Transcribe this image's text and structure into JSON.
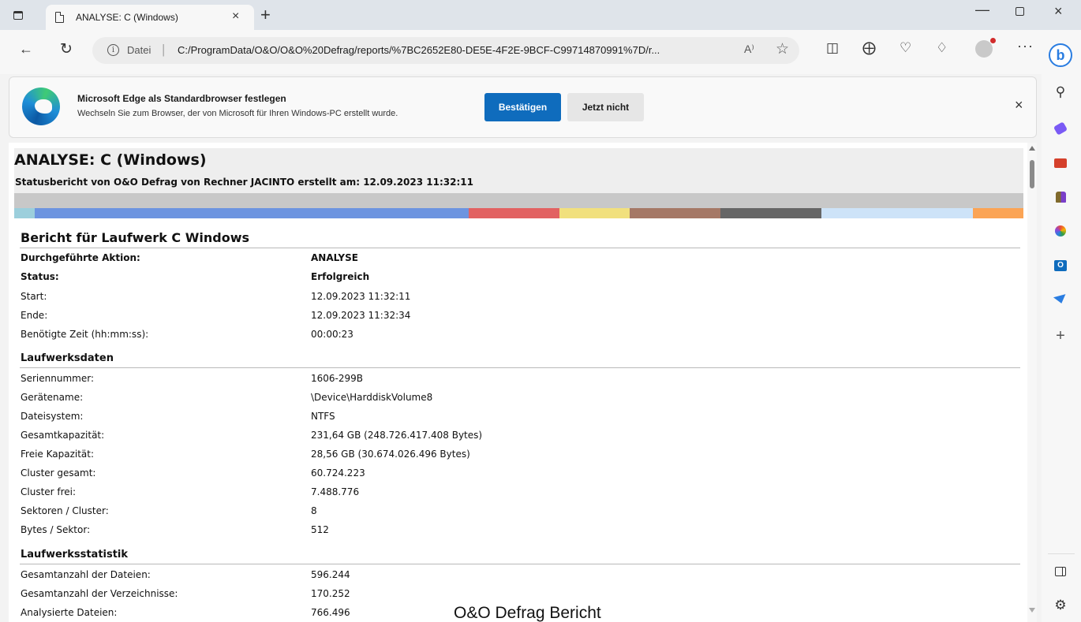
{
  "browser": {
    "tab_title": "ANALYSE: C (Windows)",
    "new_tab_symbol": "+",
    "close_symbol": "×",
    "address_scheme": "Datei",
    "url": "C:/ProgramData/O&O/O&O%20Defrag/reports/%7BC2652E80-DE5E-4F2E-9BCF-C99714870991%7D/r...",
    "read_aloud_symbol": "A⁾",
    "more_symbol": "···"
  },
  "banner": {
    "title": "Microsoft Edge als Standardbrowser festlegen",
    "text": "Wechseln Sie zum Browser, der von Microsoft für Ihren Windows-PC erstellt wurde.",
    "confirm_label": "Bestätigen",
    "dismiss_label": "Jetzt nicht"
  },
  "report": {
    "title": "ANALYSE: C (Windows)",
    "subtitle": "Statusbericht von O&O Defrag von Rechner JACINTO erstellt am: 12.09.2023 11:32:11",
    "color_bar": [
      {
        "color": "#9ccfdc",
        "share": 2
      },
      {
        "color": "#6c94e0",
        "share": 43
      },
      {
        "color": "#e26262",
        "share": 9
      },
      {
        "color": "#f1e07d",
        "share": 7
      },
      {
        "color": "#a57866",
        "share": 9
      },
      {
        "color": "#666666",
        "share": 10
      },
      {
        "color": "#cde3f8",
        "share": 15
      },
      {
        "color": "#fba455",
        "share": 5
      }
    ],
    "section_title": "Bericht für Laufwerk C Windows",
    "action": {
      "label": "Durchgeführte Aktion:",
      "value": "ANALYSE"
    },
    "status": {
      "label": "Status:",
      "value": "Erfolgreich"
    },
    "start": {
      "label": "Start:",
      "value": "12.09.2023 11:32:11"
    },
    "end": {
      "label": "Ende:",
      "value": "12.09.2023 11:32:34"
    },
    "duration": {
      "label": "Benötigte Zeit (hh:mm:ss):",
      "value": "00:00:23"
    },
    "drive_data_heading": "Laufwerksdaten",
    "drive_data": [
      {
        "label": "Seriennummer:",
        "value": "1606-299B"
      },
      {
        "label": "Gerätename:",
        "value": "\\Device\\HarddiskVolume8"
      },
      {
        "label": "Dateisystem:",
        "value": "NTFS"
      },
      {
        "label": "Gesamtkapazität:",
        "value": "231,64 GB (248.726.417.408 Bytes)"
      },
      {
        "label": "Freie Kapazität:",
        "value": "28,56 GB (30.674.026.496 Bytes)"
      },
      {
        "label": "Cluster gesamt:",
        "value": "60.724.223"
      },
      {
        "label": "Cluster frei:",
        "value": "7.488.776"
      },
      {
        "label": "Sektoren / Cluster:",
        "value": "8"
      },
      {
        "label": "Bytes / Sektor:",
        "value": "512"
      }
    ],
    "drive_stats_heading": "Laufwerksstatistik",
    "drive_stats": [
      {
        "label": "Gesamtanzahl der Dateien:",
        "value": "596.244"
      },
      {
        "label": "Gesamtanzahl der Verzeichnisse:",
        "value": "170.252"
      },
      {
        "label": "Analysierte Dateien:",
        "value": "766.496"
      }
    ]
  },
  "caption": "O&O Defrag Bericht"
}
